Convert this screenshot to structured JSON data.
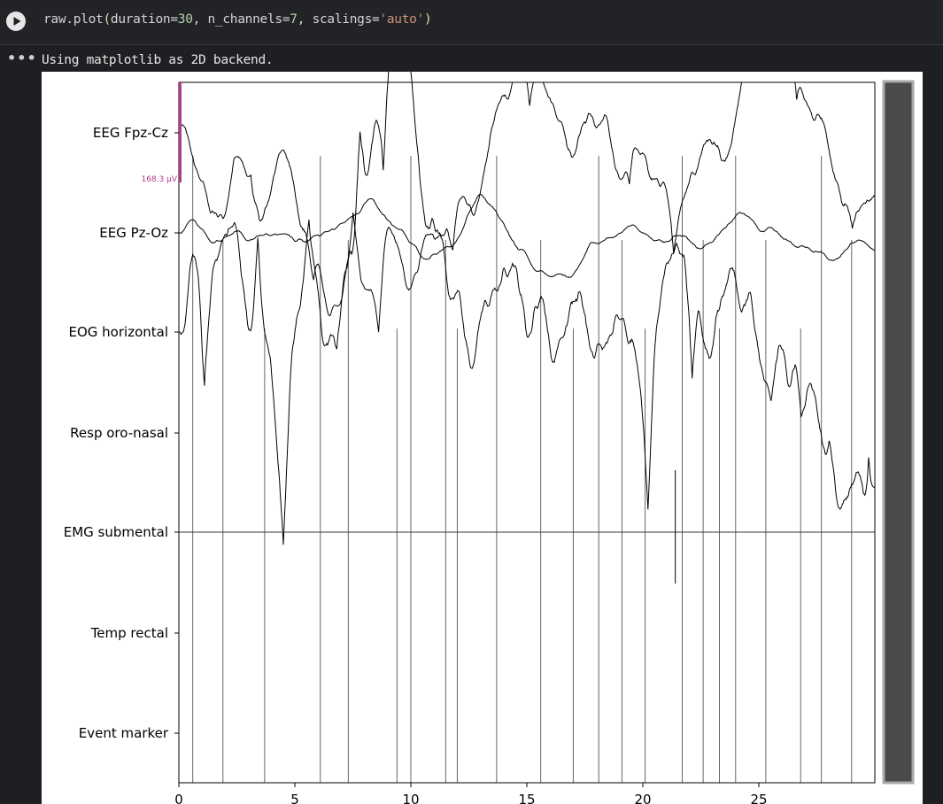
{
  "cell": {
    "code_func": "raw.plot",
    "code_arg1_key": "duration=",
    "code_arg1_val": "30",
    "code_arg2_key": "n_channels=",
    "code_arg2_val": "7",
    "code_arg3_key": "scalings=",
    "code_arg3_val": "'auto'",
    "run_icon": "play-icon",
    "output_icon": "ellipsis-icon",
    "output_text": "Using matplotlib as 2D backend."
  },
  "colors": {
    "background": "#1e1f22",
    "scale_bar": "#b03c8c",
    "trace": "#000000",
    "event_line": "#555555",
    "scrollbar_fill": "#4a4a4a",
    "scrollbar_border": "#a8a8a8"
  },
  "chart_data": {
    "type": "line",
    "xlim": [
      0,
      30
    ],
    "xticks": [
      "0",
      "5",
      "10",
      "15",
      "20",
      "25"
    ],
    "scale_label": "168.3 µV",
    "channels": [
      "EEG Fpz-Cz",
      "EEG Pz-Oz",
      "EOG horizontal",
      "Resp oro-nasal",
      "EMG submental",
      "Temp rectal",
      "Event marker"
    ],
    "event_times": [
      0.6,
      1.9,
      3.7,
      6.1,
      7.3,
      9.4,
      10.0,
      11.5,
      12.0,
      13.7,
      15.6,
      17.0,
      18.1,
      19.1,
      20.1,
      21.7,
      22.6,
      23.3,
      24.0,
      25.3,
      26.8,
      27.7,
      29.0
    ]
  }
}
